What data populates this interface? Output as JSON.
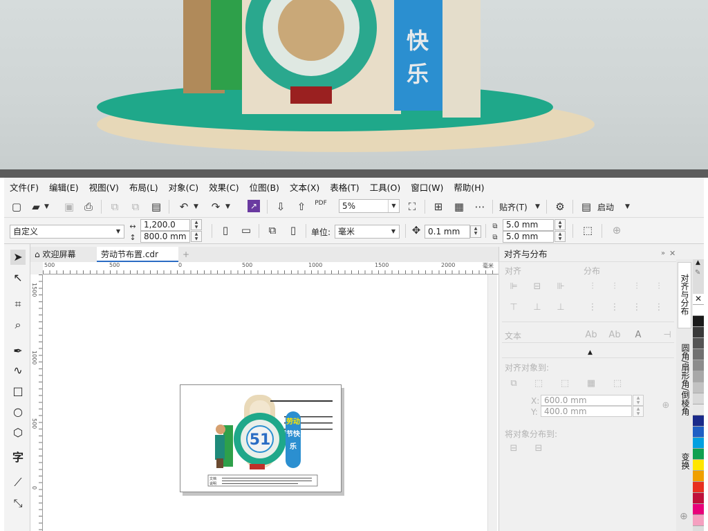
{
  "menu": [
    "文件(F)",
    "编辑(E)",
    "视图(V)",
    "布局(L)",
    "对象(C)",
    "效果(C)",
    "位图(B)",
    "文本(X)",
    "表格(T)",
    "工具(O)",
    "窗口(W)",
    "帮助(H)"
  ],
  "toolbar1": {
    "zoom": "5%",
    "snap": "贴齐(T)",
    "launch": "启动"
  },
  "toolbar2": {
    "preset": "自定义",
    "width": "1,200.0 mm",
    "height": "800.0 mm",
    "unit_label": "单位:",
    "unit": "毫米",
    "nudge": "0.1 mm",
    "dup_x": "5.0 mm",
    "dup_y": "5.0 mm"
  },
  "tabs": {
    "welcome": "欢迎屏幕",
    "doc": "劳动节布置.cdr",
    "add": "+"
  },
  "ruler": {
    "h": [
      "500",
      "0",
      "500",
      "1000",
      "1500",
      "2000"
    ],
    "v": [
      "1500",
      "1000",
      "500",
      "0"
    ],
    "unit": "毫米"
  },
  "design": {
    "banner_line1": "劳动",
    "banner_line2": "节快",
    "banner_line3": "乐",
    "badge": "51",
    "caption_a": "文档",
    "caption_b": "说明",
    "render_text_a": "快",
    "render_text_b": "乐"
  },
  "docker": {
    "title": "对齐与分布",
    "align": "对齐",
    "distribute": "分布",
    "text": "文本",
    "align_to": "对齐对象到:",
    "x_label": "X:",
    "x_value": "600.0 mm",
    "y_label": "Y:",
    "y_value": "400.0 mm",
    "distribute_to": "将对象分布到:"
  },
  "vtabs": [
    "对齐与分布",
    "圆角/扇形角/倒棱角",
    "变换"
  ],
  "palette": [
    "#ffffff",
    "#1a1a1a",
    "#3a3a3a",
    "#555555",
    "#707070",
    "#8c8c8c",
    "#a8a8a8",
    "#c2c2c2",
    "#d9d9d9",
    "#e8e8e8",
    "#1a2a8a",
    "#1f5fc4",
    "#00a0e0",
    "#10a050",
    "#ffe600",
    "#f0a000",
    "#e83020",
    "#c0103a",
    "#e8007a",
    "#f5a0c0"
  ],
  "colors": {
    "teal": "#1fa88a",
    "blue": "#2b8fd0",
    "cream": "#e9d9b8",
    "red": "#c0302a"
  }
}
